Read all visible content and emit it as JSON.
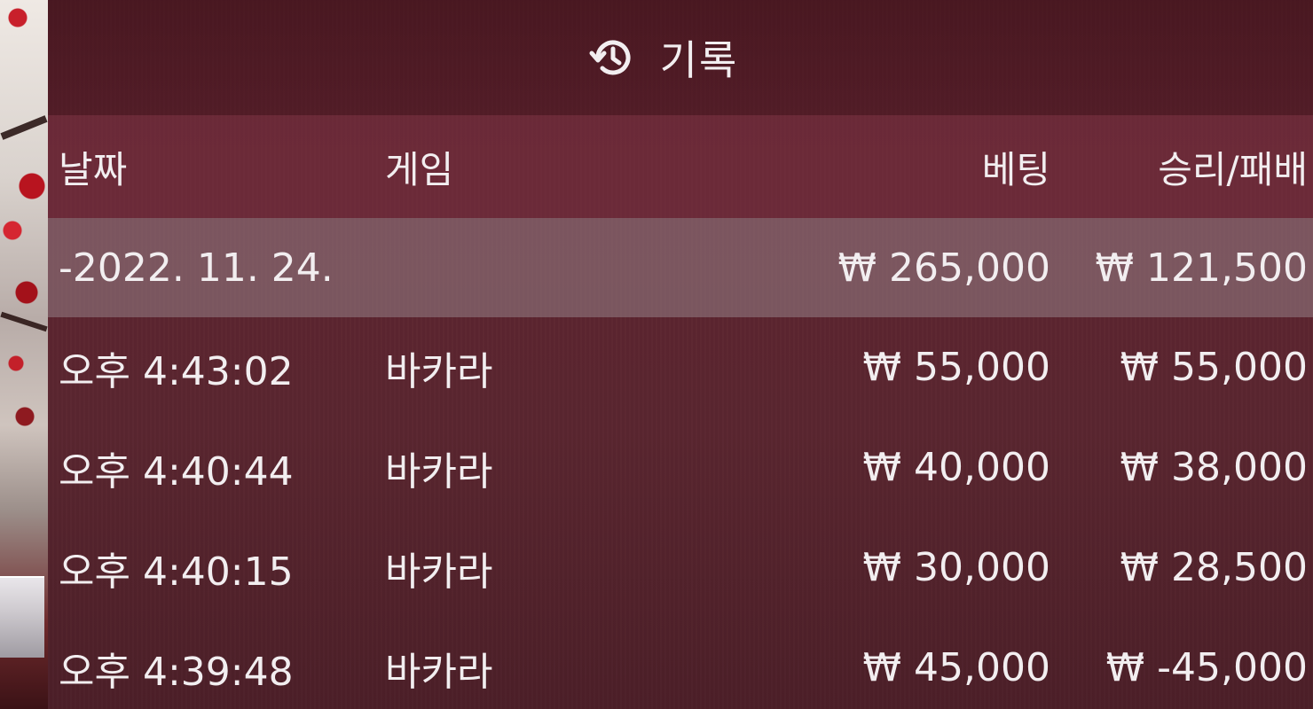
{
  "header": {
    "icon": "history-icon",
    "title": "기록"
  },
  "table": {
    "columns": {
      "date": "날짜",
      "game": "게임",
      "bet": "베팅",
      "win_loss": "승리/패배"
    },
    "group": {
      "date": "-2022. 11. 24.",
      "bet": "₩ 265,000",
      "win_loss": "₩ 121,500"
    },
    "rows": [
      {
        "time": "오후 4:43:02",
        "game": "바카라",
        "bet": "₩ 55,000",
        "win_loss": "₩ 55,000"
      },
      {
        "time": "오후 4:40:44",
        "game": "바카라",
        "bet": "₩ 40,000",
        "win_loss": "₩ 38,000"
      },
      {
        "time": "오후 4:40:15",
        "game": "바카라",
        "bet": "₩ 30,000",
        "win_loss": "₩ 28,500"
      },
      {
        "time": "오후 4:39:48",
        "game": "바카라",
        "bet": "₩ 45,000",
        "win_loss": "₩ -45,000"
      }
    ]
  },
  "colors": {
    "panel": "#5a2430",
    "header_row": "#7a3242",
    "group_row": "#8a7a7f",
    "text": "#f2eef0"
  }
}
